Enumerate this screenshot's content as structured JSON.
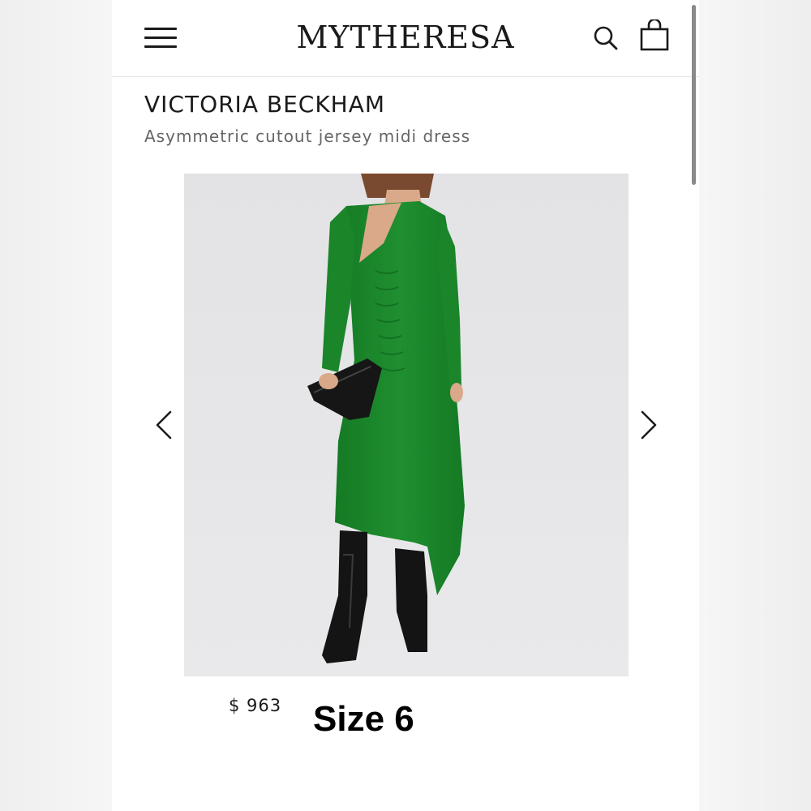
{
  "header": {
    "logo": "MYTHERESA",
    "menu_icon": "hamburger-menu-icon",
    "search_icon": "search-icon",
    "bag_icon": "shopping-bag-icon"
  },
  "product": {
    "brand": "VICTORIA BECKHAM",
    "name": "Asymmetric cutout jersey midi dress",
    "price": "$ 963",
    "size_note": "Size 6",
    "image_alt": "Model wearing green asymmetric cutout jersey midi dress with black clutch and black boots",
    "dress_color": "#1f8a2e"
  },
  "carousel": {
    "prev_icon": "chevron-left-icon",
    "next_icon": "chevron-right-icon"
  }
}
